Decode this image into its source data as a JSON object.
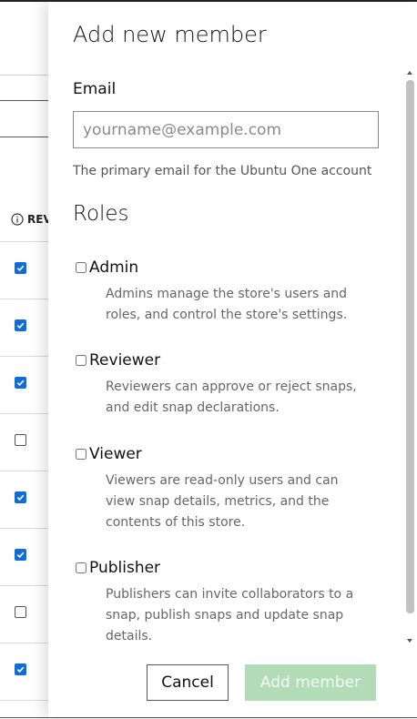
{
  "background": {
    "column_header": "REV",
    "rows": [
      {
        "checked": true
      },
      {
        "checked": true
      },
      {
        "checked": true
      },
      {
        "checked": false
      },
      {
        "checked": true
      },
      {
        "checked": true
      },
      {
        "checked": false
      },
      {
        "checked": true
      }
    ]
  },
  "panel": {
    "title": "Add new member",
    "email": {
      "label": "Email",
      "placeholder": "yourname@example.com",
      "value": "",
      "help": "The primary email for the Ubuntu One account"
    },
    "roles_title": "Roles",
    "roles": [
      {
        "name": "Admin",
        "checked": false,
        "description": "Admins manage the store's users and roles, and control the store's settings."
      },
      {
        "name": "Reviewer",
        "checked": false,
        "description": "Reviewers can approve or reject snaps, and edit snap declarations."
      },
      {
        "name": "Viewer",
        "checked": false,
        "description": "Viewers are read-only users and can view snap details, metrics, and the contents of this store."
      },
      {
        "name": "Publisher",
        "checked": false,
        "description": "Publishers can invite collaborators to a snap, publish snaps and update snap details."
      }
    ],
    "buttons": {
      "cancel": "Cancel",
      "add": "Add member"
    }
  },
  "colors": {
    "accent_blue": "#0e6ddb",
    "disabled_green": "#b1dcb7"
  }
}
